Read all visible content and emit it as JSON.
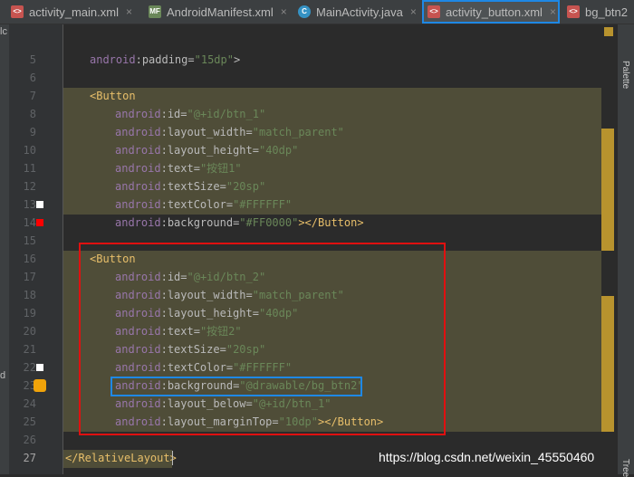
{
  "tabs": [
    {
      "label": "activity_main.xml",
      "icon": "xml-file-icon",
      "icon_text": "<>",
      "icon_color": "#c75450"
    },
    {
      "label": "AndroidManifest.xml",
      "icon": "manifest-file-icon",
      "icon_text": "MF",
      "icon_color": "#6a8759"
    },
    {
      "label": "MainActivity.java",
      "icon": "java-class-icon",
      "icon_text": "C",
      "icon_color": "#3592c4"
    },
    {
      "label": "activity_button.xml",
      "icon": "xml-file-icon",
      "icon_text": "<>",
      "icon_color": "#c75450"
    },
    {
      "label": "bg_btn2",
      "icon": "xml-file-icon",
      "icon_text": "<>",
      "icon_color": "#c75450"
    }
  ],
  "left_strip": {
    "top_label": "lc",
    "bottom_label": "d"
  },
  "right_panel": {
    "palette": "Palette",
    "tree": "Tree"
  },
  "line_numbers": [
    "5",
    "6",
    "7",
    "8",
    "9",
    "10",
    "11",
    "12",
    "13",
    "14",
    "15",
    "16",
    "17",
    "18",
    "19",
    "20",
    "21",
    "22",
    "23",
    "24",
    "25",
    "26",
    "27"
  ],
  "code": [
    {
      "ind": 1,
      "parts": [
        [
          "attr-ns",
          "android"
        ],
        [
          "punct",
          ":"
        ],
        [
          "attr-n",
          "padding"
        ],
        [
          "punct",
          "="
        ],
        [
          "val",
          "\"15dp\""
        ],
        [
          "punct",
          ">"
        ]
      ]
    },
    {
      "ind": 0,
      "parts": []
    },
    {
      "ind": 1,
      "parts": [
        [
          "tag",
          "<Button"
        ]
      ]
    },
    {
      "ind": 2,
      "parts": [
        [
          "attr-ns",
          "android"
        ],
        [
          "punct",
          ":"
        ],
        [
          "attr-n",
          "id"
        ],
        [
          "punct",
          "="
        ],
        [
          "val",
          "\"@+id/btn_1\""
        ]
      ]
    },
    {
      "ind": 2,
      "parts": [
        [
          "attr-ns",
          "android"
        ],
        [
          "punct",
          ":"
        ],
        [
          "attr-n",
          "layout_width"
        ],
        [
          "punct",
          "="
        ],
        [
          "val",
          "\"match_parent\""
        ]
      ]
    },
    {
      "ind": 2,
      "parts": [
        [
          "attr-ns",
          "android"
        ],
        [
          "punct",
          ":"
        ],
        [
          "attr-n",
          "layout_height"
        ],
        [
          "punct",
          "="
        ],
        [
          "val",
          "\"40dp\""
        ]
      ]
    },
    {
      "ind": 2,
      "parts": [
        [
          "attr-ns",
          "android"
        ],
        [
          "punct",
          ":"
        ],
        [
          "attr-n",
          "text"
        ],
        [
          "punct",
          "="
        ],
        [
          "val",
          "\"按钮1\""
        ]
      ]
    },
    {
      "ind": 2,
      "parts": [
        [
          "attr-ns",
          "android"
        ],
        [
          "punct",
          ":"
        ],
        [
          "attr-n",
          "textSize"
        ],
        [
          "punct",
          "="
        ],
        [
          "val",
          "\"20sp\""
        ]
      ]
    },
    {
      "ind": 2,
      "parts": [
        [
          "attr-ns",
          "android"
        ],
        [
          "punct",
          ":"
        ],
        [
          "attr-n",
          "textColor"
        ],
        [
          "punct",
          "="
        ],
        [
          "val",
          "\"#FFFFFF\""
        ]
      ]
    },
    {
      "ind": 2,
      "parts": [
        [
          "attr-ns",
          "android"
        ],
        [
          "punct",
          ":"
        ],
        [
          "attr-n",
          "background"
        ],
        [
          "punct",
          "="
        ],
        [
          "val",
          "\"#FF0000\""
        ],
        [
          "tag",
          "></Button>"
        ]
      ]
    },
    {
      "ind": 0,
      "parts": []
    },
    {
      "ind": 1,
      "parts": [
        [
          "tag",
          "<Button"
        ]
      ]
    },
    {
      "ind": 2,
      "parts": [
        [
          "attr-ns",
          "android"
        ],
        [
          "punct",
          ":"
        ],
        [
          "attr-n",
          "id"
        ],
        [
          "punct",
          "="
        ],
        [
          "val",
          "\"@+id/btn_2\""
        ]
      ]
    },
    {
      "ind": 2,
      "parts": [
        [
          "attr-ns",
          "android"
        ],
        [
          "punct",
          ":"
        ],
        [
          "attr-n",
          "layout_width"
        ],
        [
          "punct",
          "="
        ],
        [
          "val",
          "\"match_parent\""
        ]
      ]
    },
    {
      "ind": 2,
      "parts": [
        [
          "attr-ns",
          "android"
        ],
        [
          "punct",
          ":"
        ],
        [
          "attr-n",
          "layout_height"
        ],
        [
          "punct",
          "="
        ],
        [
          "val",
          "\"40dp\""
        ]
      ]
    },
    {
      "ind": 2,
      "parts": [
        [
          "attr-ns",
          "android"
        ],
        [
          "punct",
          ":"
        ],
        [
          "attr-n",
          "text"
        ],
        [
          "punct",
          "="
        ],
        [
          "val",
          "\"按钮2\""
        ]
      ]
    },
    {
      "ind": 2,
      "parts": [
        [
          "attr-ns",
          "android"
        ],
        [
          "punct",
          ":"
        ],
        [
          "attr-n",
          "textSize"
        ],
        [
          "punct",
          "="
        ],
        [
          "val",
          "\"20sp\""
        ]
      ]
    },
    {
      "ind": 2,
      "parts": [
        [
          "attr-ns",
          "android"
        ],
        [
          "punct",
          ":"
        ],
        [
          "attr-n",
          "textColor"
        ],
        [
          "punct",
          "="
        ],
        [
          "val",
          "\"#FFFFFF\""
        ]
      ]
    },
    {
      "ind": 2,
      "parts": [
        [
          "attr-ns",
          "android"
        ],
        [
          "punct",
          ":"
        ],
        [
          "attr-n",
          "background"
        ],
        [
          "punct",
          "="
        ],
        [
          "val",
          "\"@drawable/bg_btn2\""
        ]
      ]
    },
    {
      "ind": 2,
      "parts": [
        [
          "attr-ns",
          "android"
        ],
        [
          "punct",
          ":"
        ],
        [
          "attr-n",
          "layout_below"
        ],
        [
          "punct",
          "="
        ],
        [
          "val",
          "\"@+id/btn_1\""
        ]
      ]
    },
    {
      "ind": 2,
      "parts": [
        [
          "attr-ns",
          "android"
        ],
        [
          "punct",
          ":"
        ],
        [
          "attr-n",
          "layout_marginTop"
        ],
        [
          "punct",
          "="
        ],
        [
          "val",
          "\"10dp\""
        ],
        [
          "tag",
          "></Button>"
        ]
      ]
    },
    {
      "ind": 0,
      "parts": []
    },
    {
      "ind": 0,
      "parts": [
        [
          "tag",
          "</RelativeLayout>"
        ]
      ]
    }
  ],
  "colors": {
    "red_annotation": "#e01010",
    "blue_annotation": "#1e88e5",
    "highlight": "#4f4d38"
  },
  "watermark": "https://blog.csdn.net/weixin_45550460"
}
